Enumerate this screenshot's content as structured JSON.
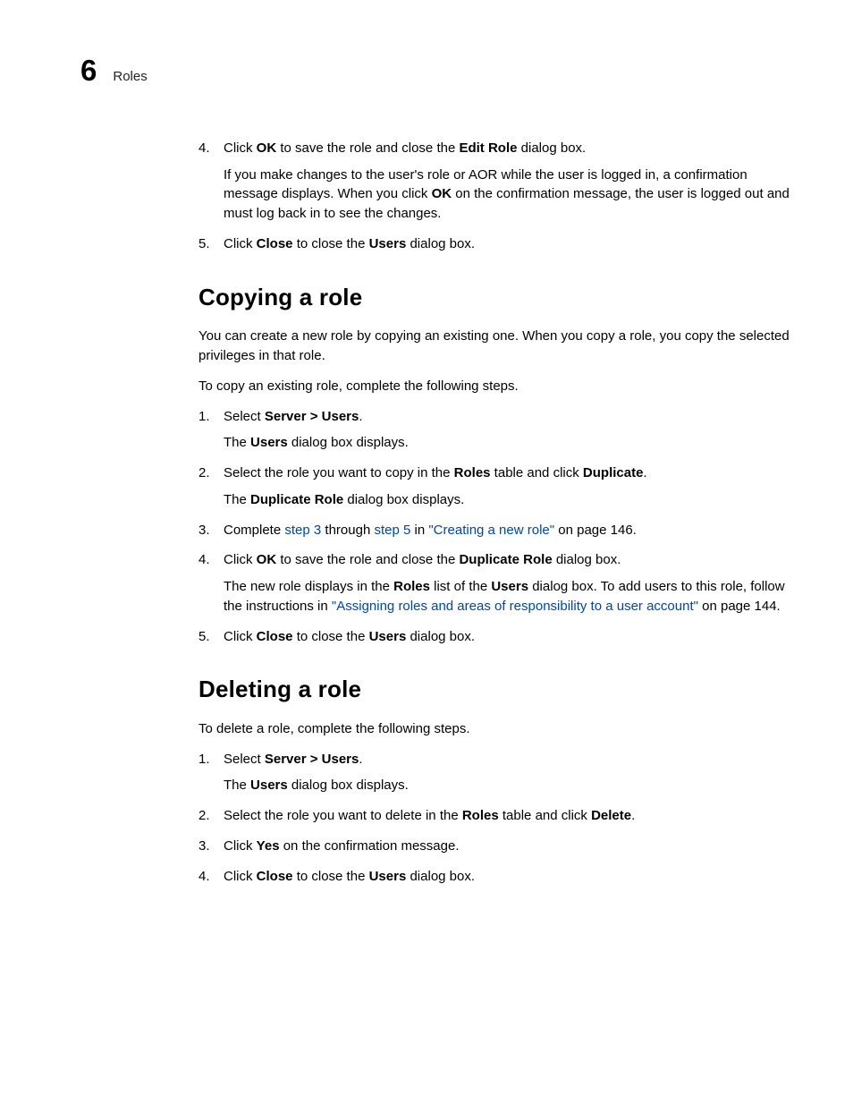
{
  "header": {
    "chapter_number": "6",
    "chapter_title": "Roles"
  },
  "top_steps": [
    {
      "num": "4.",
      "line": {
        "pre": "Click ",
        "b1": "OK",
        "mid": " to save the role and close the ",
        "b2": "Edit Role",
        "post": " dialog box."
      },
      "sub": {
        "pre": "If you make changes to the user's role or AOR while the user is logged in, a confirmation message displays. When you click ",
        "b1": "OK",
        "post": " on the confirmation message, the user is logged out and must log back in to see the changes."
      }
    },
    {
      "num": "5.",
      "line": {
        "pre": "Click ",
        "b1": "Close",
        "mid": " to close the ",
        "b2": "Users",
        "post": " dialog box."
      }
    }
  ],
  "copying": {
    "heading": "Copying a role",
    "intro1": "You can create a new role by copying an existing one. When you copy a role, you copy the selected privileges in that role.",
    "intro2": "To copy an existing role, complete the following steps.",
    "steps": [
      {
        "num": "1.",
        "line": {
          "pre": "Select ",
          "b1": "Server > Users",
          "post": "."
        },
        "sub": {
          "pre": "The ",
          "b1": "Users",
          "post": " dialog box displays."
        }
      },
      {
        "num": "2.",
        "line": {
          "pre": "Select the role you want to copy in the ",
          "b1": "Roles",
          "mid": " table and click ",
          "b2": "Duplicate",
          "post": "."
        },
        "sub": {
          "pre": "The ",
          "b1": "Duplicate Role",
          "post": " dialog box displays."
        }
      },
      {
        "num": "3.",
        "line_links": {
          "pre": "Complete ",
          "l1": "step 3",
          "mid1": " through ",
          "l2": "step 5",
          "mid2": " in ",
          "l3": "\"Creating a new role\"",
          "post": " on page 146."
        }
      },
      {
        "num": "4.",
        "line": {
          "pre": "Click ",
          "b1": "OK",
          "mid": " to save the role and close the ",
          "b2": "Duplicate Role",
          "post": " dialog box."
        },
        "sub_links": {
          "pre": "The new role displays in the ",
          "b1": "Roles",
          "mid1": " list of the ",
          "b2": "Users",
          "mid2": " dialog box. To add users to this role, follow the instructions in ",
          "l1": "\"Assigning roles and areas of responsibility to a user account\"",
          "post": " on page 144."
        }
      },
      {
        "num": "5.",
        "line": {
          "pre": "Click ",
          "b1": "Close",
          "mid": " to close the ",
          "b2": "Users",
          "post": " dialog box."
        }
      }
    ]
  },
  "deleting": {
    "heading": "Deleting a role",
    "intro": "To delete a role, complete the following steps.",
    "steps": [
      {
        "num": "1.",
        "line": {
          "pre": "Select ",
          "b1": "Server > Users",
          "post": "."
        },
        "sub": {
          "pre": "The ",
          "b1": "Users",
          "post": " dialog box displays."
        }
      },
      {
        "num": "2.",
        "line": {
          "pre": "Select the role you want to delete in the ",
          "b1": "Roles",
          "mid": " table and click ",
          "b2": "Delete",
          "post": "."
        }
      },
      {
        "num": "3.",
        "line": {
          "pre": "Click ",
          "b1": "Yes",
          "post": " on the confirmation message."
        }
      },
      {
        "num": "4.",
        "line": {
          "pre": "Click ",
          "b1": "Close",
          "mid": " to close the ",
          "b2": "Users",
          "post": " dialog box."
        }
      }
    ]
  }
}
